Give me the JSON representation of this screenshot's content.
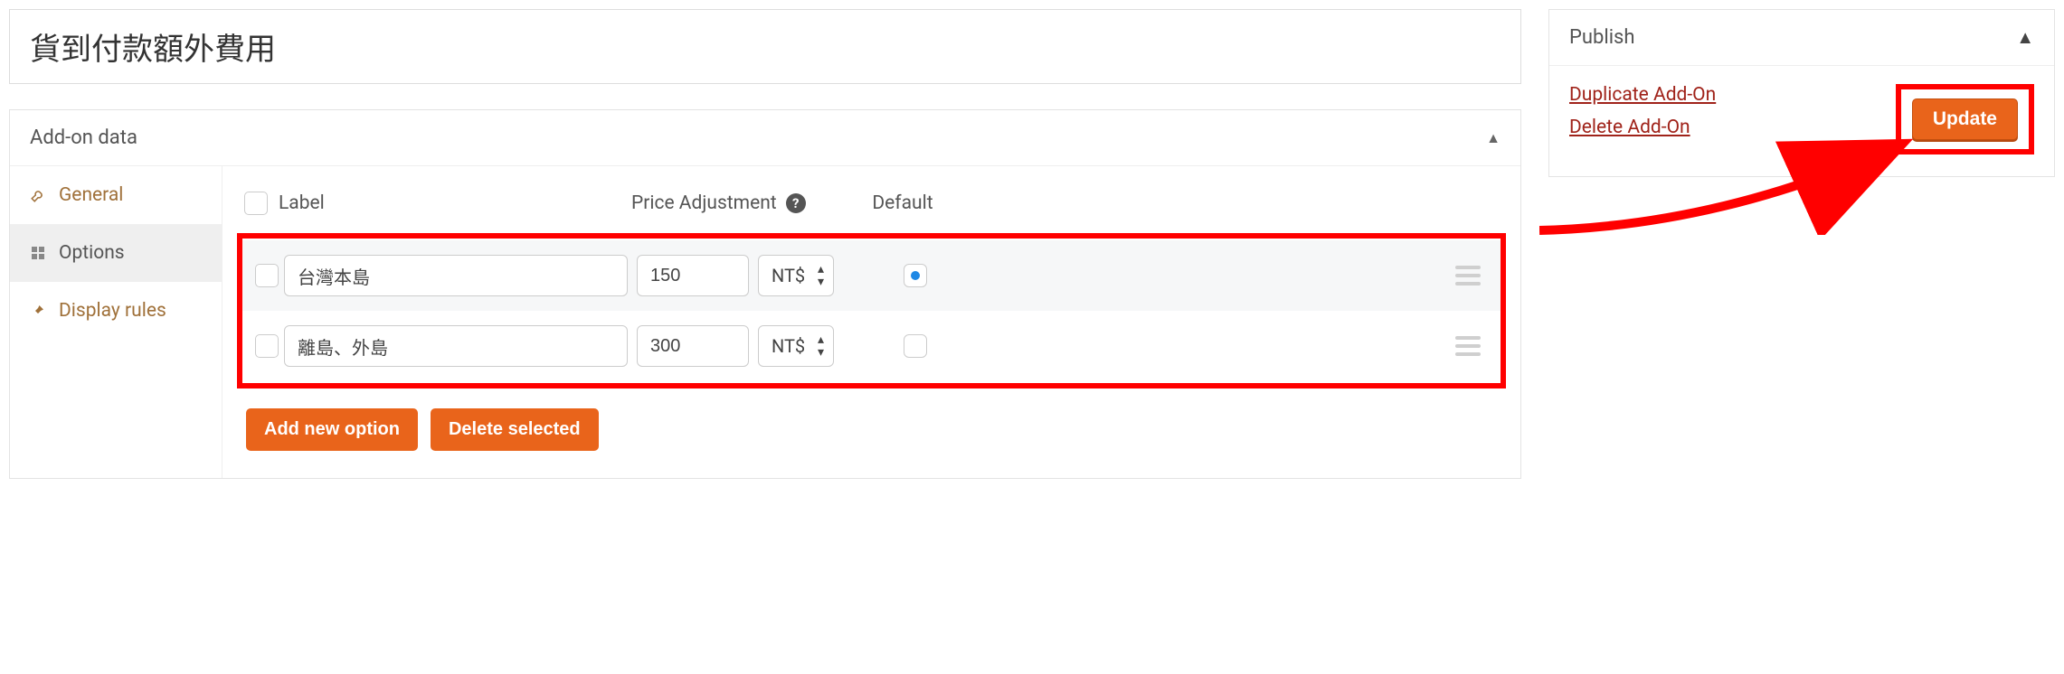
{
  "title": "貨到付款額外費用",
  "addon_panel": {
    "title": "Add-on data"
  },
  "sidebar": {
    "items": [
      {
        "label": "General"
      },
      {
        "label": "Options"
      },
      {
        "label": "Display rules"
      }
    ]
  },
  "headers": {
    "label": "Label",
    "price": "Price Adjustment",
    "default": "Default"
  },
  "rows": [
    {
      "label": "台灣本島",
      "price": "150",
      "currency": "NT$",
      "default": true
    },
    {
      "label": "離島、外島",
      "price": "300",
      "currency": "NT$",
      "default": false
    }
  ],
  "buttons": {
    "add_option": "Add new option",
    "delete_selected": "Delete selected",
    "update": "Update"
  },
  "publish": {
    "title": "Publish",
    "duplicate": "Duplicate Add-On",
    "delete": "Delete Add-On"
  }
}
